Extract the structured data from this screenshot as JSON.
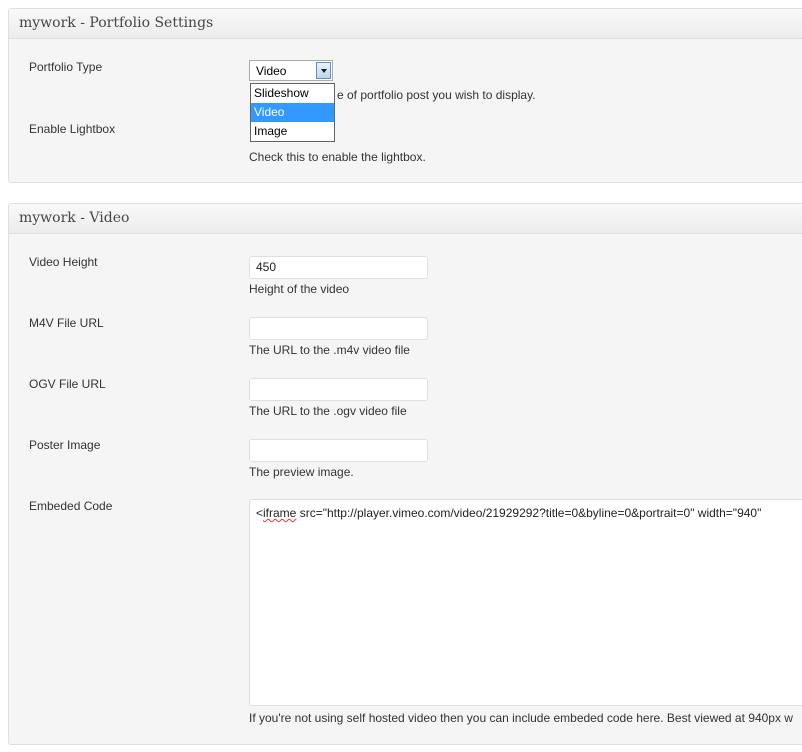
{
  "portfolio_settings": {
    "title": "mywork - Portfolio Settings",
    "portfolio_type": {
      "label": "Portfolio Type",
      "selected": "Video",
      "options": [
        "Slideshow",
        "Video",
        "Image"
      ],
      "description": "Select the type of portfolio post you wish to display.",
      "description_visible": "e of portfolio post you wish to display."
    },
    "lightbox": {
      "label": "Enable Lightbox",
      "description": "Check this to enable the lightbox."
    }
  },
  "video": {
    "title": "mywork - Video",
    "height": {
      "label": "Video Height",
      "value": "450",
      "description": "Height of the video"
    },
    "m4v": {
      "label": "M4V File URL",
      "value": "",
      "description": "The URL to the .m4v video file"
    },
    "ogv": {
      "label": "OGV File URL",
      "value": "",
      "description": "The URL to the .ogv video file"
    },
    "poster": {
      "label": "Poster Image",
      "value": "",
      "description": "The preview image."
    },
    "embed": {
      "label": "Embeded Code",
      "value_prefix": "<",
      "value_misspelled": "iframe",
      "value_rest": " src=\"http://player.vimeo.com/video/21929292?title=0&byline=0&portrait=0\" width=\"940\"",
      "description": "If you're not using self hosted video then you can include embeded code here. Best viewed at 940px w"
    }
  }
}
